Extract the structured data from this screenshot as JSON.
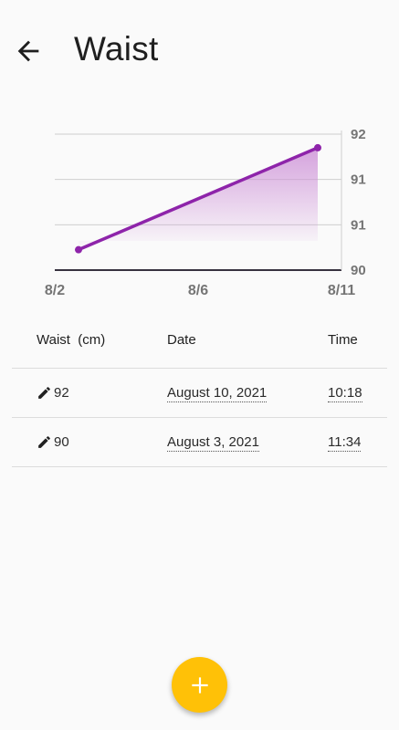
{
  "header": {
    "title": "Waist"
  },
  "chart_data": {
    "type": "area",
    "x": [
      "2021-08-03",
      "2021-08-10"
    ],
    "values": [
      90.3,
      91.8
    ],
    "x_ticks": [
      "8/2",
      "8/6",
      "8/11"
    ],
    "y_ticks": [
      "92",
      "91",
      "91",
      "90"
    ],
    "ylim": [
      90,
      92
    ],
    "grid": true,
    "colors": {
      "line": "#8e24aa",
      "fill": "#ce93d8"
    }
  },
  "table": {
    "columns": [
      "Waist  (cm)",
      "Date",
      "Time"
    ],
    "rows": [
      {
        "value": "92",
        "date": "August 10, 2021",
        "time": "10:18"
      },
      {
        "value": "90",
        "date": "August 3, 2021",
        "time": "11:34"
      }
    ]
  },
  "icons": {
    "back": "arrow-left-icon",
    "edit": "pencil-icon",
    "add": "plus-icon"
  },
  "colors": {
    "fab": "#ffc107"
  }
}
